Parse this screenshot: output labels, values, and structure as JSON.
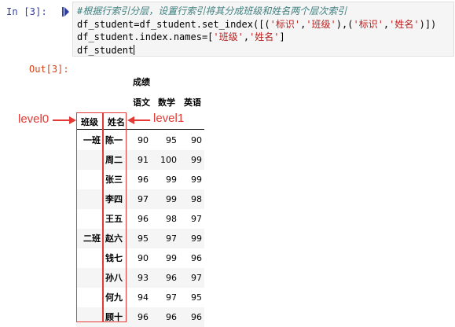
{
  "input_cell": {
    "prompt": "In  [3]:",
    "code": {
      "comment": "#根据行索引分层，设置行索引将其分成班级和姓名两个层次索引",
      "line2_a": "df_student=df_student.set_index([(",
      "line2_s1": "'标识'",
      "line2_b": ",",
      "line2_s2": "'班级'",
      "line2_c": "),(",
      "line2_s3": "'标识'",
      "line2_d": ",",
      "line2_s4": "'姓名'",
      "line2_e": ")])",
      "line3_a": "df_student.index.names=[",
      "line3_s1": "'班级'",
      "line3_b": ",",
      "line3_s2": "'姓名'",
      "line3_c": "]",
      "line4": "df_student"
    }
  },
  "output_cell": {
    "prompt": "Out[3]:"
  },
  "dataframe": {
    "column_group": "成绩",
    "columns": [
      "语文",
      "数学",
      "英语"
    ],
    "index_names": [
      "班级",
      "姓名"
    ],
    "rows": [
      {
        "level0": "一班",
        "level1": "陈一",
        "values": [
          "90",
          "95",
          "90"
        ]
      },
      {
        "level0": "",
        "level1": "周二",
        "values": [
          "91",
          "100",
          "99"
        ]
      },
      {
        "level0": "",
        "level1": "张三",
        "values": [
          "96",
          "99",
          "99"
        ]
      },
      {
        "level0": "",
        "level1": "李四",
        "values": [
          "97",
          "99",
          "98"
        ]
      },
      {
        "level0": "",
        "level1": "王五",
        "values": [
          "96",
          "98",
          "97"
        ]
      },
      {
        "level0": "二班",
        "level1": "赵六",
        "values": [
          "95",
          "97",
          "99"
        ]
      },
      {
        "level0": "",
        "level1": "钱七",
        "values": [
          "90",
          "99",
          "96"
        ]
      },
      {
        "level0": "",
        "level1": "孙八",
        "values": [
          "93",
          "96",
          "97"
        ]
      },
      {
        "level0": "",
        "level1": "何九",
        "values": [
          "94",
          "97",
          "95"
        ]
      },
      {
        "level0": "",
        "level1": "顾十",
        "values": [
          "96",
          "96",
          "96"
        ]
      }
    ]
  },
  "annotations": {
    "level0_label": "level0",
    "level1_label": "level1",
    "color": "#e53935"
  }
}
